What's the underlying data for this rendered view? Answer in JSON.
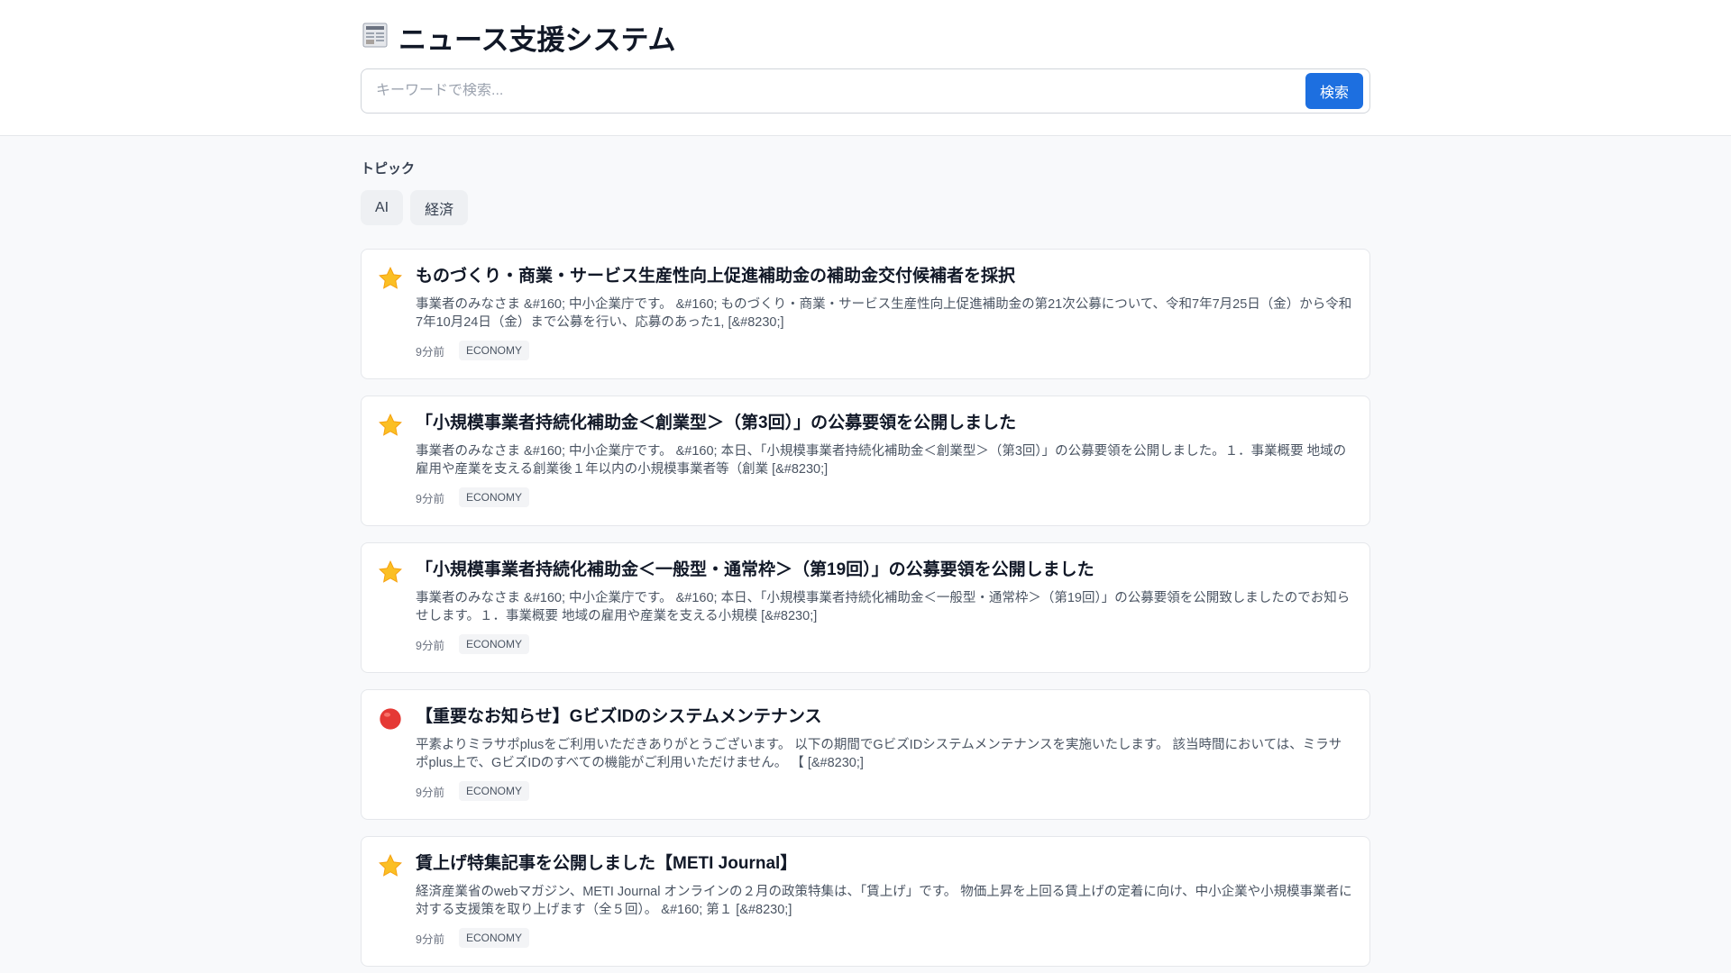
{
  "header": {
    "title": "ニュース支援システム",
    "search_placeholder": "キーワードで検索...",
    "search_value": "",
    "search_button": "検索"
  },
  "topics": {
    "label": "トピック",
    "items": [
      "AI",
      "経済"
    ]
  },
  "articles": [
    {
      "icon": "star-icon",
      "title": "ものづくり・商業・サービス生産性向上促進補助金の補助金交付候補者を採択",
      "summary": "事業者のみなさま &#160; 中小企業庁です。 &#160; ものづくり・商業・サービス生産性向上促進補助金の第21次公募について、令和7年7月25日（金）から令和7年10月24日（金）まで公募を行い、応募のあった1, [&#8230;]",
      "time": "9分前",
      "tag": "ECONOMY"
    },
    {
      "icon": "star-icon",
      "title": "「小規模事業者持続化補助金＜創業型＞（第3回）」の公募要領を公開しました",
      "summary": "事業者のみなさま &#160; 中小企業庁です。 &#160; 本日、「小規模事業者持続化補助金＜創業型＞（第3回）」の公募要領を公開しました。１．事業概要 地域の雇用や産業を支える創業後１年以内の小規模事業者等（創業 [&#8230;]",
      "time": "9分前",
      "tag": "ECONOMY"
    },
    {
      "icon": "star-icon",
      "title": "「小規模事業者持続化補助金＜一般型・通常枠＞（第19回）」の公募要領を公開しました",
      "summary": "事業者のみなさま &#160; 中小企業庁です。 &#160; 本日、「小規模事業者持続化補助金＜一般型・通常枠＞（第19回）」の公募要領を公開致しましたのでお知らせします。１．事業概要 地域の雇用や産業を支える小規模 [&#8230;]",
      "time": "9分前",
      "tag": "ECONOMY"
    },
    {
      "icon": "red-circle-icon",
      "title": "【重要なお知らせ】GビズIDのシステムメンテナンス",
      "summary": "平素よりミラサポplusをご利用いただきありがとうございます。 以下の期間でGビズIDシステムメンテナンスを実施いたします。 該当時間においては、ミラサポplus上で、GビズIDのすべての機能がご利用いただけません。 【 [&#8230;]",
      "time": "9分前",
      "tag": "ECONOMY"
    },
    {
      "icon": "star-icon",
      "title": "賃上げ特集記事を公開しました【METI Journal】",
      "summary": "経済産業省のwebマガジン、METI Journal オンラインの２月の政策特集は、「賃上げ」です。 物価上昇を上回る賃上げの定着に向け、中小企業や小規模事業者に対する支援策を取り上げます（全５回）。 &#160; 第１ [&#8230;]",
      "time": "9分前",
      "tag": "ECONOMY"
    }
  ]
}
